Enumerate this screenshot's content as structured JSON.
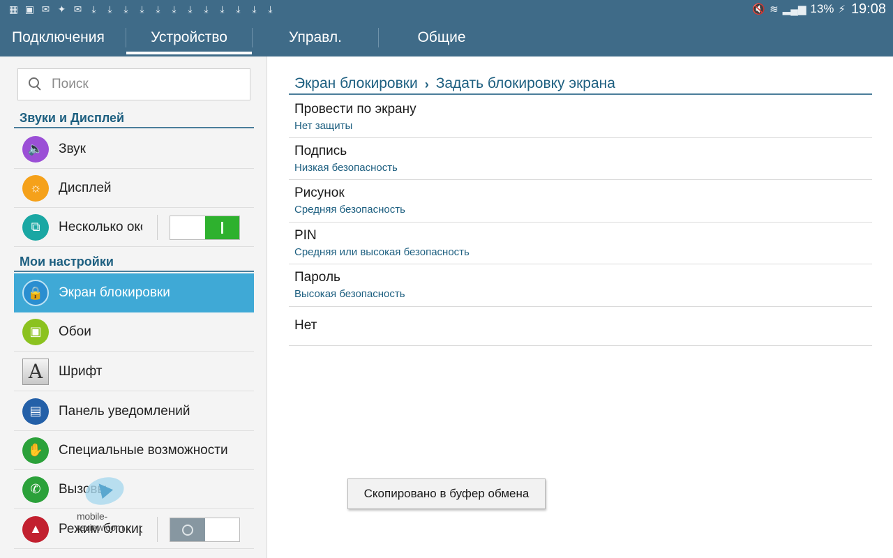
{
  "status_bar": {
    "notification_icons": [
      "sim-icon",
      "image-icon",
      "mail-icon",
      "twitter-icon",
      "gmail-icon",
      "download-icon",
      "download-icon",
      "download-icon",
      "download-icon",
      "download-icon",
      "download-icon",
      "download-icon",
      "download-icon",
      "download-icon",
      "download-icon",
      "download-icon",
      "download-icon"
    ],
    "battery_percent": "13%",
    "time": "19:08"
  },
  "tabs": [
    {
      "label": "Подключения",
      "active": false
    },
    {
      "label": "Устройство",
      "active": true
    },
    {
      "label": "Управл.",
      "active": false
    },
    {
      "label": "Общие",
      "active": false
    }
  ],
  "search": {
    "placeholder": "Поиск"
  },
  "sidebar": {
    "section1": "Звуки и Дисплей",
    "section2": "Мои настройки",
    "items": [
      {
        "label": "Звук",
        "icon": "sound-icon",
        "color": "#9b4fd6"
      },
      {
        "label": "Дисплей",
        "icon": "brightness-icon",
        "color": "#f5a11a"
      },
      {
        "label": "Несколько окон",
        "icon": "multiwindow-icon",
        "color": "#1aa7a3",
        "toggle": "on"
      },
      {
        "label": "Экран блокировки",
        "icon": "lock-screen-icon",
        "color": "#2a8ed0",
        "active": true
      },
      {
        "label": "Обои",
        "icon": "wallpaper-icon",
        "color": "#8bc21f"
      },
      {
        "label": "Шрифт",
        "icon": "font-icon",
        "glyph": "A"
      },
      {
        "label": "Панель уведомлений",
        "icon": "notification-panel-icon",
        "color": "#2460a8"
      },
      {
        "label": "Специальные возможности",
        "icon": "accessibility-hand-icon",
        "color": "#2ba13a"
      },
      {
        "label": "Вызовы",
        "icon": "phone-icon",
        "color": "#2ba13a"
      },
      {
        "label": "Режим блокировки",
        "icon": "blocking-mode-icon",
        "color": "#c2202f",
        "toggle": "off"
      }
    ]
  },
  "watermark": {
    "text": "mobile-review.com"
  },
  "breadcrumb": {
    "parent": "Экран блокировки",
    "current": "Задать блокировку экрана"
  },
  "options": [
    {
      "title": "Провести по экрану",
      "subtitle": "Нет защиты"
    },
    {
      "title": "Подпись",
      "subtitle": "Низкая безопасность"
    },
    {
      "title": "Рисунок",
      "subtitle": "Средняя безопасность"
    },
    {
      "title": "PIN",
      "subtitle": "Средняя или высокая безопасность"
    },
    {
      "title": "Пароль",
      "subtitle": "Высокая безопасность"
    },
    {
      "title": "Нет",
      "subtitle": ""
    }
  ],
  "toast": {
    "text": "Скопировано в буфер обмена"
  }
}
